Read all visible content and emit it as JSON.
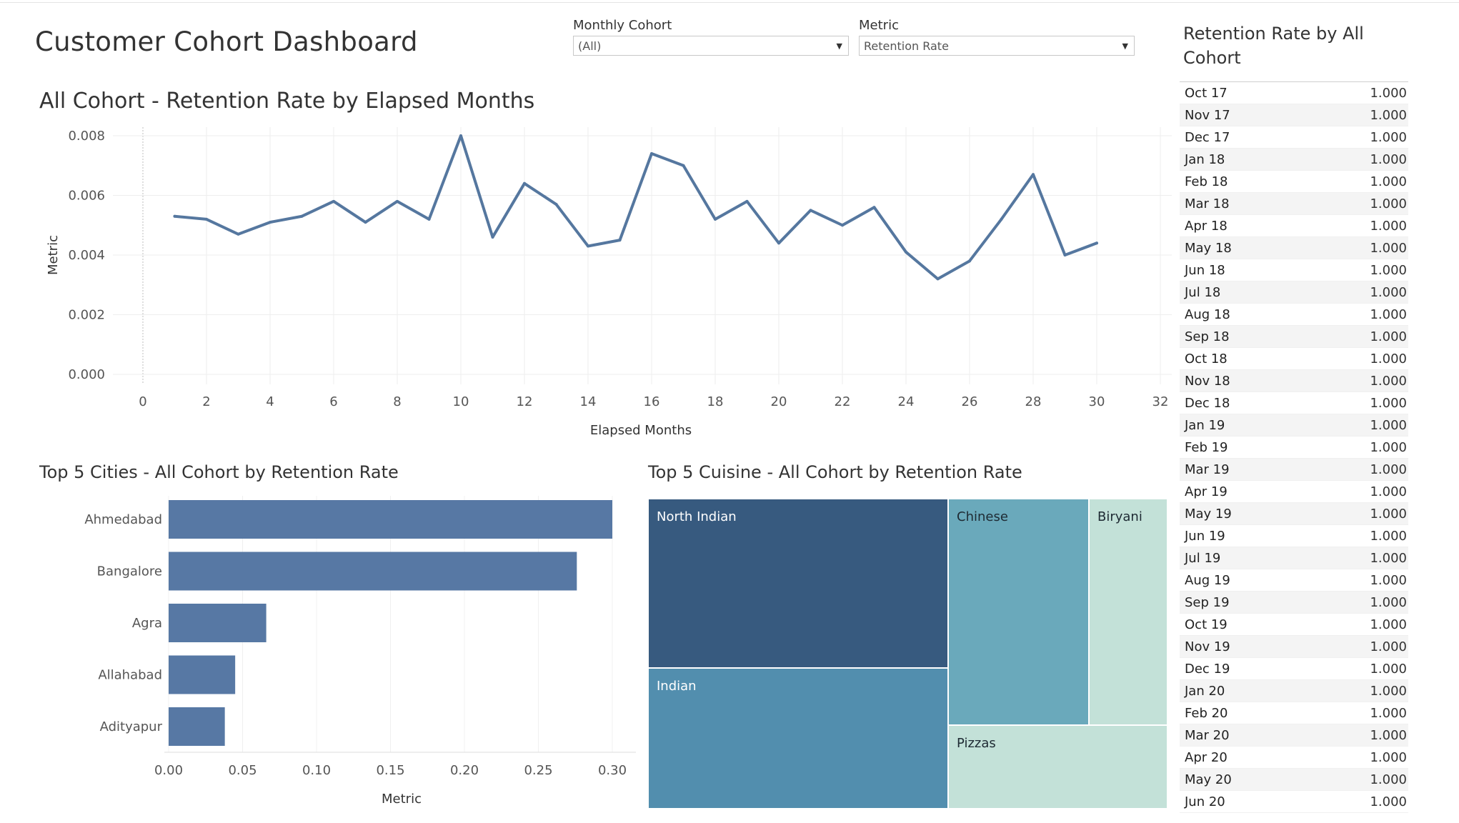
{
  "dashboard": {
    "title": "Customer Cohort Dashboard"
  },
  "filters": {
    "cohort": {
      "label": "Monthly Cohort",
      "value": "(All)"
    },
    "metric": {
      "label": "Metric",
      "value": "Retention Rate"
    }
  },
  "icons": {
    "dropdown": "chevron-down-icon"
  },
  "colors": {
    "line": "#55779f",
    "bar": "#5778a4",
    "tm_dark": "#375a7f",
    "tm_mid": "#528eae",
    "tm_light": "#6aa9bb",
    "tm_pale": "#c3e1d8"
  },
  "chart_data": [
    {
      "type": "line",
      "title": "All Cohort - Retention Rate by Elapsed Months",
      "xlabel": "Elapsed Months",
      "ylabel": "Metric",
      "xlim": [
        0,
        32
      ],
      "ylim": [
        0,
        0.008
      ],
      "xticks": [
        "0",
        "2",
        "4",
        "6",
        "8",
        "10",
        "12",
        "14",
        "16",
        "18",
        "20",
        "22",
        "24",
        "26",
        "28",
        "30",
        "32"
      ],
      "yticks": [
        "0.000",
        "0.002",
        "0.004",
        "0.006",
        "0.008"
      ],
      "grid": true,
      "x": [
        1,
        2,
        3,
        4,
        5,
        6,
        7,
        8,
        9,
        10,
        11,
        12,
        13,
        14,
        15,
        16,
        17,
        18,
        19,
        20,
        21,
        22,
        23,
        24,
        25,
        26,
        27,
        28,
        29,
        30
      ],
      "values": [
        0.0053,
        0.0052,
        0.0047,
        0.0051,
        0.0053,
        0.0058,
        0.0051,
        0.0058,
        0.0052,
        0.008,
        0.0046,
        0.0064,
        0.0057,
        0.0043,
        0.0045,
        0.0074,
        0.007,
        0.0052,
        0.0058,
        0.0044,
        0.0055,
        0.005,
        0.0056,
        0.0041,
        0.0032,
        0.0038,
        0.0052,
        0.0067,
        0.004,
        0.0044
      ]
    },
    {
      "type": "bar",
      "orientation": "horizontal",
      "title": "Top 5 Cities - All Cohort by Retention Rate",
      "xlabel": "Metric",
      "categories": [
        "Ahmedabad",
        "Bangalore",
        "Agra",
        "Allahabad",
        "Adityapur"
      ],
      "values": [
        0.3,
        0.276,
        0.066,
        0.045,
        0.038
      ],
      "xlim": [
        0,
        0.3
      ],
      "xticks": [
        "0.00",
        "0.05",
        "0.10",
        "0.15",
        "0.20",
        "0.25",
        "0.30"
      ],
      "grid": true
    },
    {
      "type": "treemap",
      "title": "Top 5 Cuisine - All Cohort by Retention Rate",
      "categories": [
        "North Indian",
        "Indian",
        "Chinese",
        "Biryani",
        "Pizzas"
      ],
      "values": [
        0.245,
        0.203,
        0.153,
        0.086,
        0.088
      ]
    },
    {
      "type": "table",
      "title": "Retention Rate by All Cohort",
      "rows": [
        {
          "month": "Oct 17",
          "value": "1.000"
        },
        {
          "month": "Nov 17",
          "value": "1.000"
        },
        {
          "month": "Dec 17",
          "value": "1.000"
        },
        {
          "month": "Jan 18",
          "value": "1.000"
        },
        {
          "month": "Feb 18",
          "value": "1.000"
        },
        {
          "month": "Mar 18",
          "value": "1.000"
        },
        {
          "month": "Apr 18",
          "value": "1.000"
        },
        {
          "month": "May 18",
          "value": "1.000"
        },
        {
          "month": "Jun 18",
          "value": "1.000"
        },
        {
          "month": "Jul 18",
          "value": "1.000"
        },
        {
          "month": "Aug 18",
          "value": "1.000"
        },
        {
          "month": "Sep 18",
          "value": "1.000"
        },
        {
          "month": "Oct 18",
          "value": "1.000"
        },
        {
          "month": "Nov 18",
          "value": "1.000"
        },
        {
          "month": "Dec 18",
          "value": "1.000"
        },
        {
          "month": "Jan 19",
          "value": "1.000"
        },
        {
          "month": "Feb 19",
          "value": "1.000"
        },
        {
          "month": "Mar 19",
          "value": "1.000"
        },
        {
          "month": "Apr 19",
          "value": "1.000"
        },
        {
          "month": "May 19",
          "value": "1.000"
        },
        {
          "month": "Jun 19",
          "value": "1.000"
        },
        {
          "month": "Jul 19",
          "value": "1.000"
        },
        {
          "month": "Aug 19",
          "value": "1.000"
        },
        {
          "month": "Sep 19",
          "value": "1.000"
        },
        {
          "month": "Oct 19",
          "value": "1.000"
        },
        {
          "month": "Nov 19",
          "value": "1.000"
        },
        {
          "month": "Dec 19",
          "value": "1.000"
        },
        {
          "month": "Jan 20",
          "value": "1.000"
        },
        {
          "month": "Feb 20",
          "value": "1.000"
        },
        {
          "month": "Mar 20",
          "value": "1.000"
        },
        {
          "month": "Apr 20",
          "value": "1.000"
        },
        {
          "month": "May 20",
          "value": "1.000"
        },
        {
          "month": "Jun 20",
          "value": "1.000"
        }
      ]
    }
  ]
}
